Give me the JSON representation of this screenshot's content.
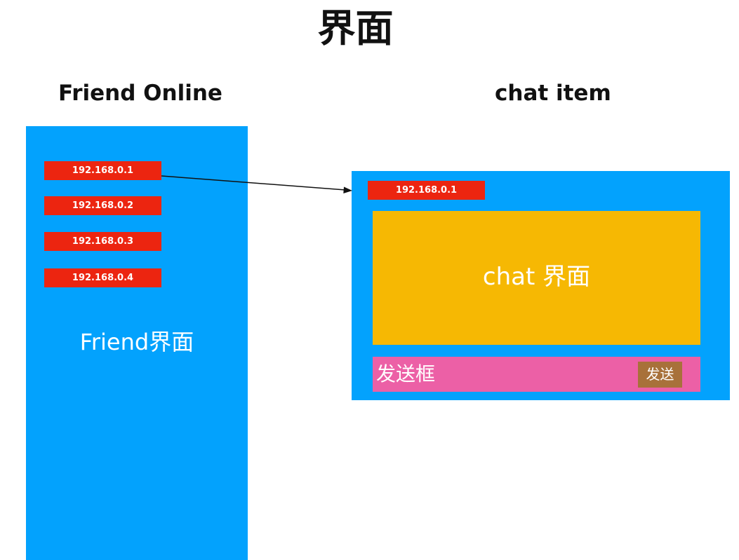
{
  "page": {
    "title": "界面"
  },
  "friend_section": {
    "title": "Friend Online",
    "panel_label": "Friend界面",
    "items": [
      "192.168.0.1",
      "192.168.0.2",
      "192.168.0.3",
      "192.168.0.4"
    ]
  },
  "chat_section": {
    "title": "chat item",
    "header_ip": "192.168.0.1",
    "chat_area_label": "chat 界面",
    "send_box_label": "发送框",
    "send_button_label": "发送"
  },
  "colors": {
    "panel_blue": "#03a2fd",
    "ip_red": "#ec2510",
    "chat_area": "#f6b803",
    "send_box": "#ec60a6",
    "send_button": "#a8713a"
  }
}
